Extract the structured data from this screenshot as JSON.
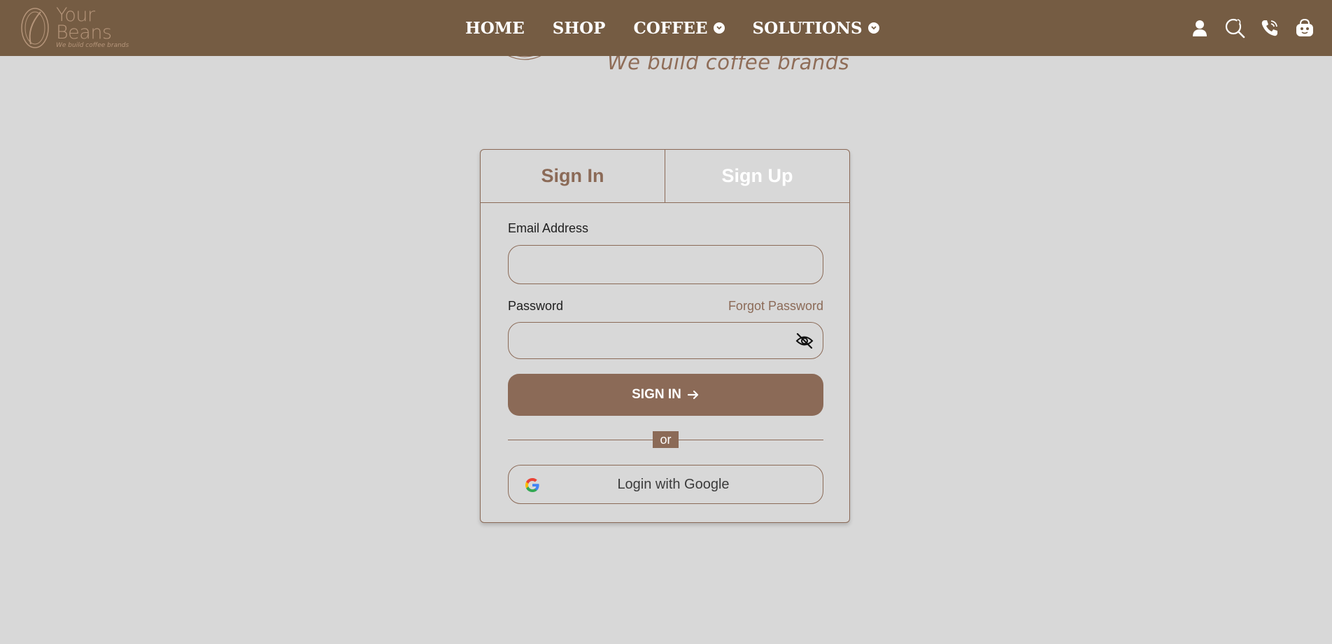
{
  "brand": {
    "name_line1": "Your",
    "name_line2": "Beans",
    "tagline": "We build coffee brands"
  },
  "nav": {
    "links": [
      {
        "label": "HOME",
        "has_dropdown": false
      },
      {
        "label": "SHOP",
        "has_dropdown": false
      },
      {
        "label": "COFFEE",
        "has_dropdown": true
      },
      {
        "label": "SOLUTIONS",
        "has_dropdown": true
      }
    ],
    "icons": [
      "user-icon",
      "search-icon",
      "phone-icon",
      "cart-icon"
    ]
  },
  "hero": {
    "tagline": "We build coffee brands"
  },
  "auth": {
    "tabs": [
      {
        "label": "Sign In",
        "active": true
      },
      {
        "label": "Sign Up",
        "active": false
      }
    ],
    "email_label": "Email Address",
    "email_value": "",
    "password_label": "Password",
    "password_value": "",
    "forgot_label": "Forgot Password",
    "signin_label": "SIGN IN",
    "or_label": "or",
    "google_label": "Login with Google"
  },
  "colors": {
    "nav_bg": "#755c43",
    "accent": "#8b6a57",
    "page_bg": "#d8d8d8"
  }
}
